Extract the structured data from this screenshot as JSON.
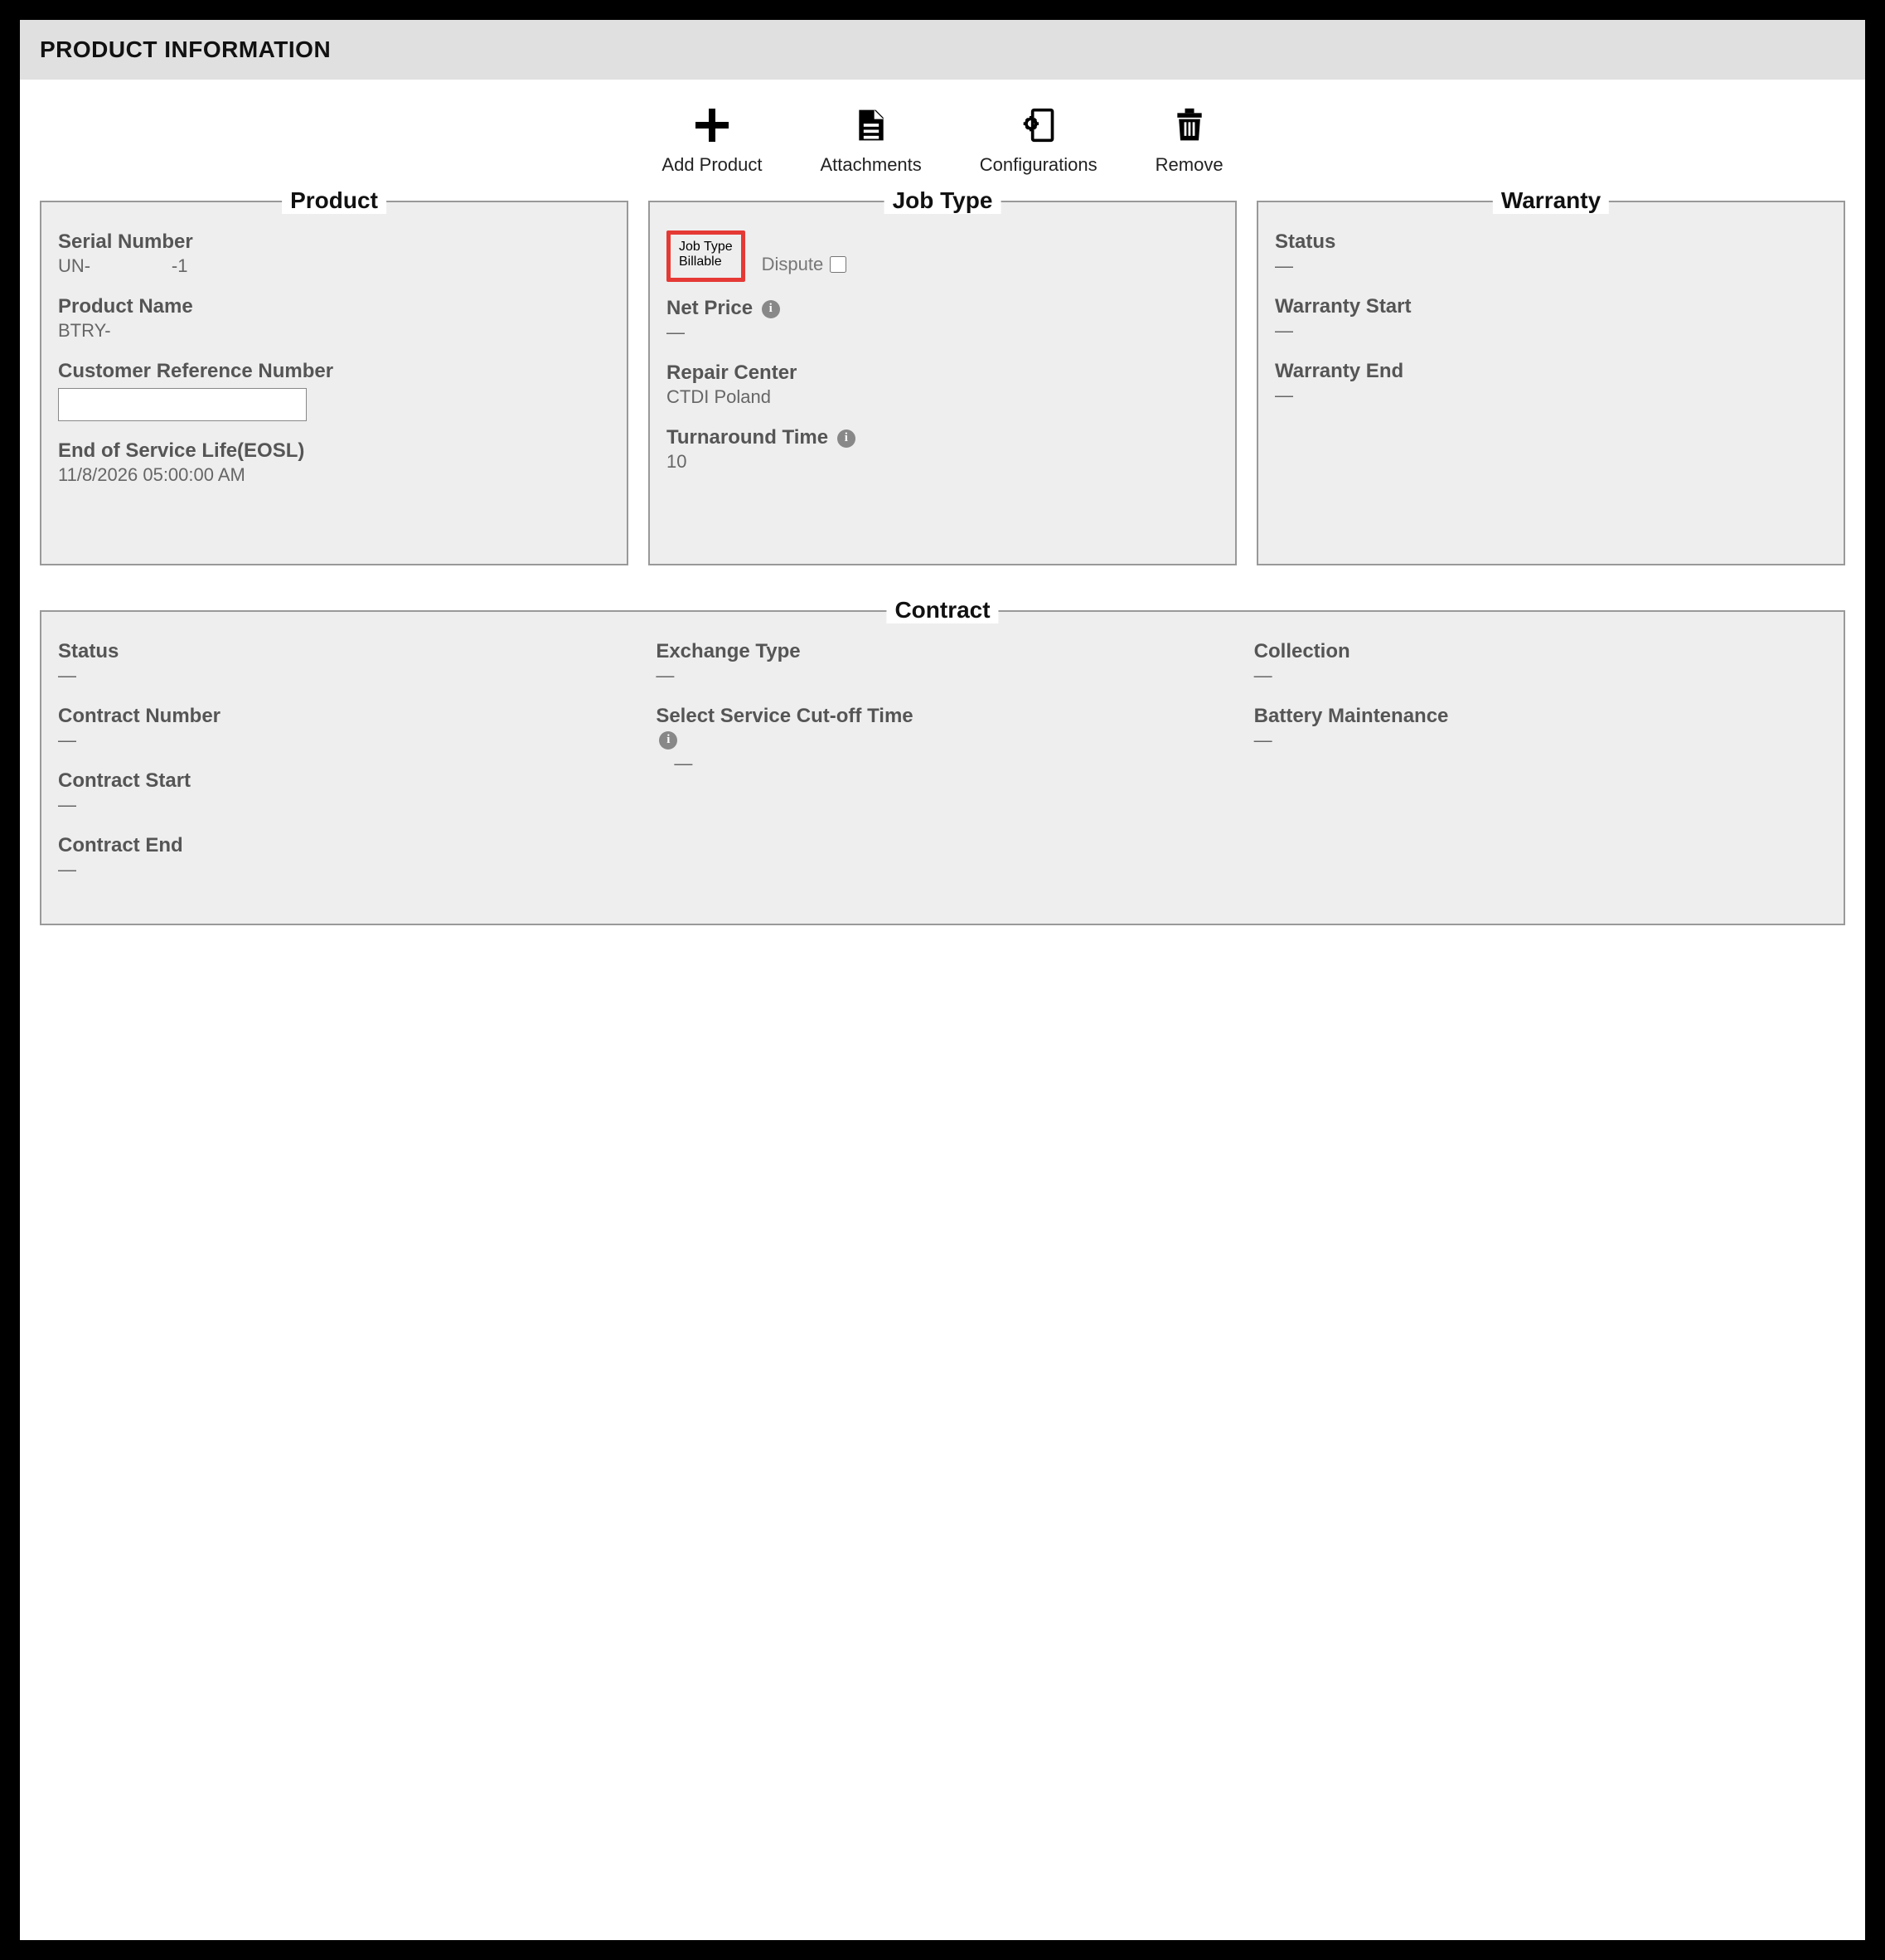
{
  "header": {
    "title": "PRODUCT INFORMATION"
  },
  "toolbar": {
    "add_product": "Add Product",
    "attachments": "Attachments",
    "configurations": "Configurations",
    "remove": "Remove"
  },
  "panels": {
    "product": {
      "legend": "Product",
      "serial_label": "Serial Number",
      "serial_value": "UN-                -1",
      "product_name_label": "Product Name",
      "product_name_value": "BTRY-",
      "crn_label": "Customer Reference Number",
      "crn_value": "",
      "eosl_label": "End of Service Life(EOSL)",
      "eosl_value": "11/8/2026 05:00:00 AM"
    },
    "jobtype": {
      "legend": "Job Type",
      "jobtype_label": "Job Type",
      "jobtype_value": "Billable",
      "dispute_label": "Dispute",
      "net_price_label": "Net Price",
      "net_price_value": "—",
      "repair_center_label": "Repair Center",
      "repair_center_value": "CTDI Poland",
      "turnaround_label": "Turnaround Time",
      "turnaround_value": "10"
    },
    "warranty": {
      "legend": "Warranty",
      "status_label": "Status",
      "status_value": "—",
      "start_label": "Warranty Start",
      "start_value": "—",
      "end_label": "Warranty End",
      "end_value": "—"
    },
    "contract": {
      "legend": "Contract",
      "status_label": "Status",
      "status_value": "—",
      "number_label": "Contract Number",
      "number_value": "—",
      "start_label": "Contract Start",
      "start_value": "—",
      "end_label": "Contract End",
      "end_value": "—",
      "exchange_label": "Exchange Type",
      "exchange_value": "—",
      "cutoff_label": "Select Service Cut-off Time",
      "cutoff_value": "—",
      "collection_label": "Collection",
      "collection_value": "—",
      "battery_label": "Battery Maintenance",
      "battery_value": "—"
    }
  }
}
